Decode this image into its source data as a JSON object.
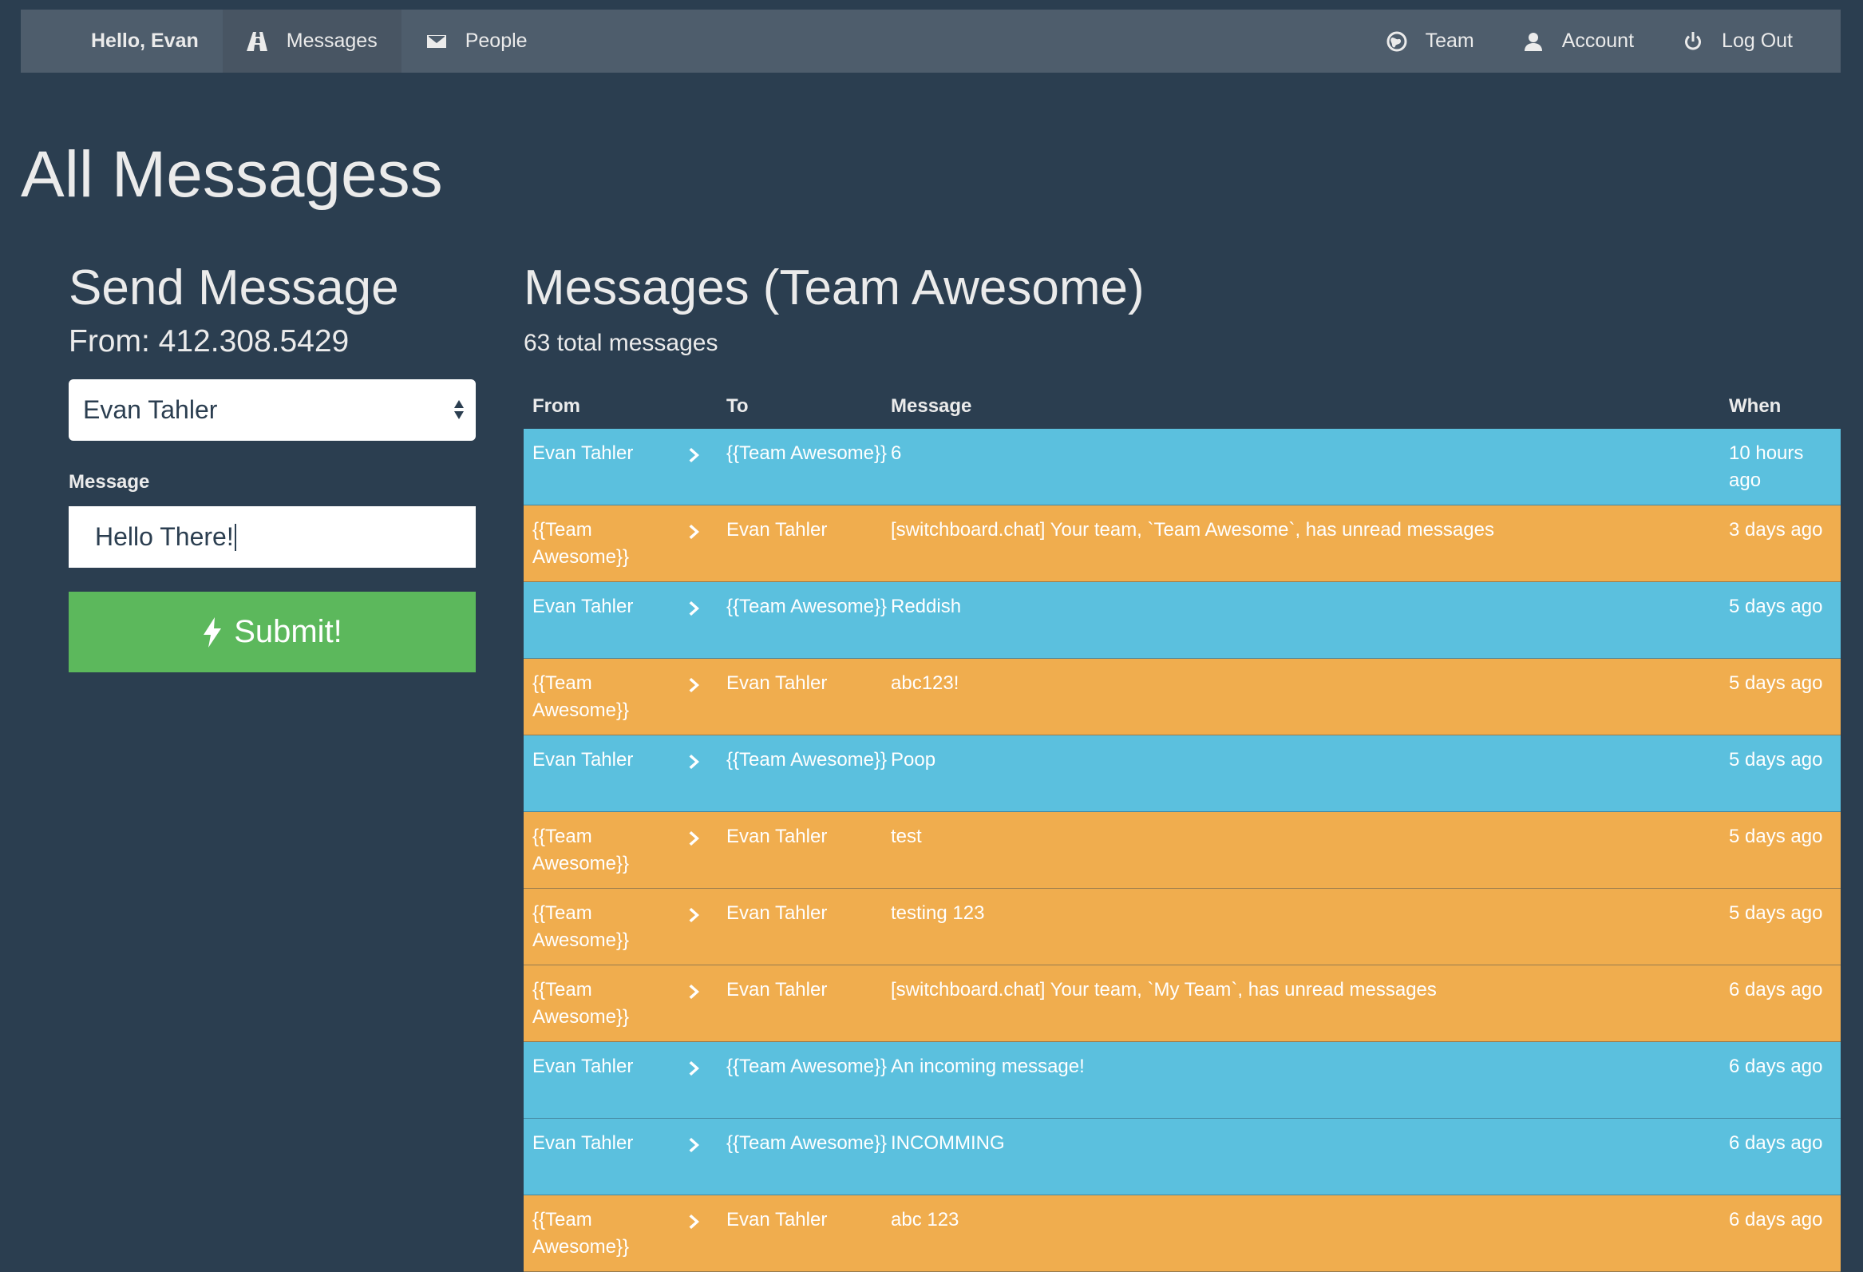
{
  "nav": {
    "brand": "Hello, Evan",
    "left_items": [
      {
        "label": "Messages",
        "icon": "road-icon"
      },
      {
        "label": "People",
        "icon": "envelope-icon"
      }
    ],
    "right_items": [
      {
        "label": "Team",
        "icon": "globe-icon"
      },
      {
        "label": "Account",
        "icon": "user-icon"
      },
      {
        "label": "Log Out",
        "icon": "power-icon"
      }
    ]
  },
  "page": {
    "title": "All Messagess"
  },
  "send": {
    "title": "Send Message",
    "from": "From: 412.308.5429",
    "recipient_selected": "Evan Tahler",
    "message_label": "Message",
    "message_value": "Hello There!",
    "submit_label": "Submit!"
  },
  "messages": {
    "title": "Messages (Team Awesome)",
    "count_text": "63 total messages",
    "columns": {
      "from": "From",
      "to": "To",
      "message": "Message",
      "when": "When"
    },
    "rows": [
      {
        "from": "Evan Tahler",
        "to": "{{Team Awesome}}",
        "message": "6",
        "when": "10 hours ago",
        "color": "blue"
      },
      {
        "from": "{{Team Awesome}}",
        "to": "Evan Tahler",
        "message": "[switchboard.chat] Your team, `Team Awesome`, has unread messages",
        "when": "3 days ago",
        "color": "orange"
      },
      {
        "from": "Evan Tahler",
        "to": "{{Team Awesome}}",
        "message": "Reddish",
        "when": "5 days ago",
        "color": "blue"
      },
      {
        "from": "{{Team Awesome}}",
        "to": "Evan Tahler",
        "message": "abc123!",
        "when": "5 days ago",
        "color": "orange"
      },
      {
        "from": "Evan Tahler",
        "to": "{{Team Awesome}}",
        "message": "Poop",
        "when": "5 days ago",
        "color": "blue"
      },
      {
        "from": "{{Team Awesome}}",
        "to": "Evan Tahler",
        "message": "test",
        "when": "5 days ago",
        "color": "orange"
      },
      {
        "from": "{{Team Awesome}}",
        "to": "Evan Tahler",
        "message": "testing 123",
        "when": "5 days ago",
        "color": "orange"
      },
      {
        "from": "{{Team Awesome}}",
        "to": "Evan Tahler",
        "message": "[switchboard.chat] Your team, `My Team`, has unread messages",
        "when": "6 days ago",
        "color": "orange"
      },
      {
        "from": "Evan Tahler",
        "to": "{{Team Awesome}}",
        "message": "An incoming message!",
        "when": "6 days ago",
        "color": "blue"
      },
      {
        "from": "Evan Tahler",
        "to": "{{Team Awesome}}",
        "message": "INCOMMING",
        "when": "6 days ago",
        "color": "blue"
      },
      {
        "from": "{{Team Awesome}}",
        "to": "Evan Tahler",
        "message": "abc 123",
        "when": "6 days ago",
        "color": "orange"
      }
    ]
  },
  "colors": {
    "background": "#2b3e50",
    "navbar": "#4e5d6c",
    "incoming_row": "#5bc0de",
    "outgoing_row": "#f0ad4e",
    "submit": "#5cb85c"
  }
}
